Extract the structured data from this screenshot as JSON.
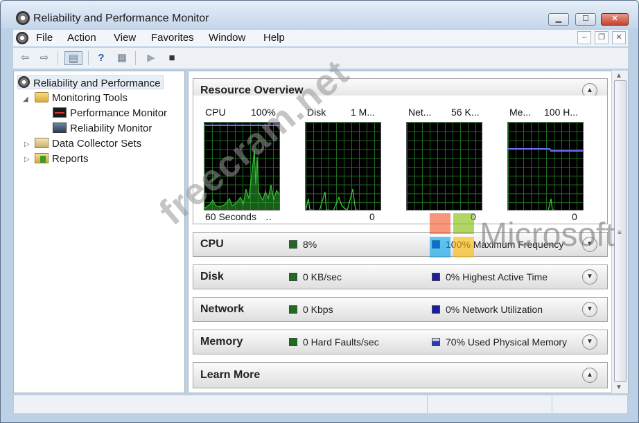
{
  "window": {
    "title": "Reliability and Performance Monitor"
  },
  "menu": {
    "items": [
      "File",
      "Action",
      "View",
      "Favorites",
      "Window",
      "Help"
    ],
    "mdi_min": "–",
    "mdi_restore": "❐",
    "mdi_close": "✕"
  },
  "titlebar_buttons": {
    "min": "▁",
    "max": "☐",
    "close": "✕"
  },
  "toolbar": {
    "back": "⇦",
    "forward": "⇨",
    "console_tree": "▤",
    "help": "?",
    "properties": "▦",
    "play": "▶",
    "stop": "■"
  },
  "tree": {
    "root": "Reliability and Performance",
    "monitoring_tools": "Monitoring Tools",
    "performance_monitor": "Performance Monitor",
    "reliability_monitor": "Reliability Monitor",
    "data_collector_sets": "Data Collector Sets",
    "reports": "Reports"
  },
  "overview": {
    "title": "Resource Overview",
    "graphs": [
      {
        "name": "CPU",
        "scale": "100%",
        "foot_left": "60 Seconds",
        "foot_right": "‥"
      },
      {
        "name": "Disk",
        "scale": "1 M...",
        "foot_left": "",
        "foot_right": "0"
      },
      {
        "name": "Net...",
        "scale": "56 K...",
        "foot_left": "",
        "foot_right": "0"
      },
      {
        "name": "Me...",
        "scale": "100 H...",
        "foot_left": "",
        "foot_right": "0"
      }
    ]
  },
  "sections": {
    "cpu": {
      "title": "CPU",
      "stat1": "8%",
      "stat2": "100% Maximum Frequency"
    },
    "disk": {
      "title": "Disk",
      "stat1": "0 KB/sec",
      "stat2": "0% Highest Active Time"
    },
    "network": {
      "title": "Network",
      "stat1": "0 Kbps",
      "stat2": "0% Network Utilization"
    },
    "memory": {
      "title": "Memory",
      "stat1": "0 Hard Faults/sec",
      "stat2": "70% Used Physical Memory"
    },
    "learn_more": {
      "title": "Learn More"
    }
  },
  "colors": {
    "graph_green": "#3cd23c",
    "graph_blue": "#6b6bff",
    "indicator_green": "#1f6b1f",
    "indicator_blue": "#1c1c9c"
  },
  "watermark": {
    "text": "freecram.net",
    "brand": "Microsoft"
  }
}
